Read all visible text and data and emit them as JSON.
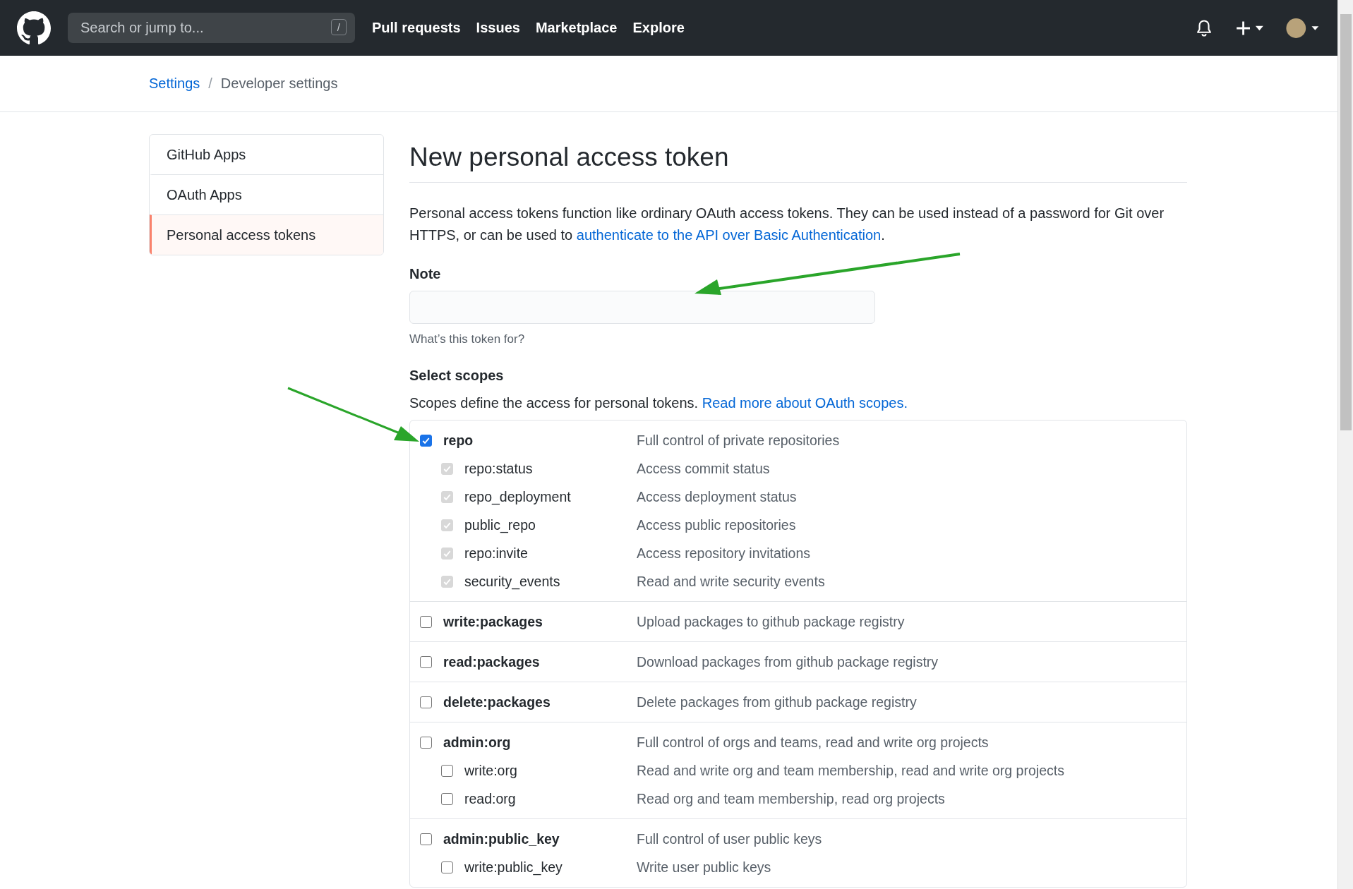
{
  "header": {
    "search": {
      "placeholder": "Search or jump to...",
      "shortcut": "/"
    },
    "nav": [
      "Pull requests",
      "Issues",
      "Marketplace",
      "Explore"
    ]
  },
  "breadcrumb": {
    "link": "Settings",
    "separator": "/",
    "current": "Developer settings"
  },
  "sidebar": {
    "items": [
      {
        "label": "GitHub Apps",
        "selected": false
      },
      {
        "label": "OAuth Apps",
        "selected": false
      },
      {
        "label": "Personal access tokens",
        "selected": true
      }
    ]
  },
  "main": {
    "title": "New personal access token",
    "intro": "Personal access tokens function like ordinary OAuth access tokens. They can be used instead of a password for Git over HTTPS, or can be used to ",
    "intro_link": "authenticate to the API over Basic Authentication",
    "intro_end": ".",
    "note": {
      "label": "Note",
      "hint": "What’s this token for?"
    },
    "scopes_heading": "Select scopes",
    "scopes_text": "Scopes define the access for personal tokens. ",
    "scopes_link": "Read more about OAuth scopes.",
    "scopes": [
      {
        "name": "repo",
        "description": "Full control of private repositories",
        "checked": true,
        "children": [
          {
            "name": "repo:status",
            "description": "Access commit status",
            "checked": true,
            "disabled": true
          },
          {
            "name": "repo_deployment",
            "description": "Access deployment status",
            "checked": true,
            "disabled": true
          },
          {
            "name": "public_repo",
            "description": "Access public repositories",
            "checked": true,
            "disabled": true
          },
          {
            "name": "repo:invite",
            "description": "Access repository invitations",
            "checked": true,
            "disabled": true
          },
          {
            "name": "security_events",
            "description": "Read and write security events",
            "checked": true,
            "disabled": true
          }
        ]
      },
      {
        "name": "write:packages",
        "description": "Upload packages to github package registry",
        "checked": false
      },
      {
        "name": "read:packages",
        "description": "Download packages from github package registry",
        "checked": false
      },
      {
        "name": "delete:packages",
        "description": "Delete packages from github package registry",
        "checked": false
      },
      {
        "name": "admin:org",
        "description": "Full control of orgs and teams, read and write org projects",
        "checked": false,
        "children": [
          {
            "name": "write:org",
            "description": "Read and write org and team membership, read and write org projects",
            "checked": false,
            "disabled": false
          },
          {
            "name": "read:org",
            "description": "Read org and team membership, read org projects",
            "checked": false,
            "disabled": false
          }
        ]
      },
      {
        "name": "admin:public_key",
        "description": "Full control of user public keys",
        "checked": false,
        "children": [
          {
            "name": "write:public_key",
            "description": "Write user public keys",
            "checked": false,
            "disabled": false
          }
        ]
      }
    ]
  }
}
